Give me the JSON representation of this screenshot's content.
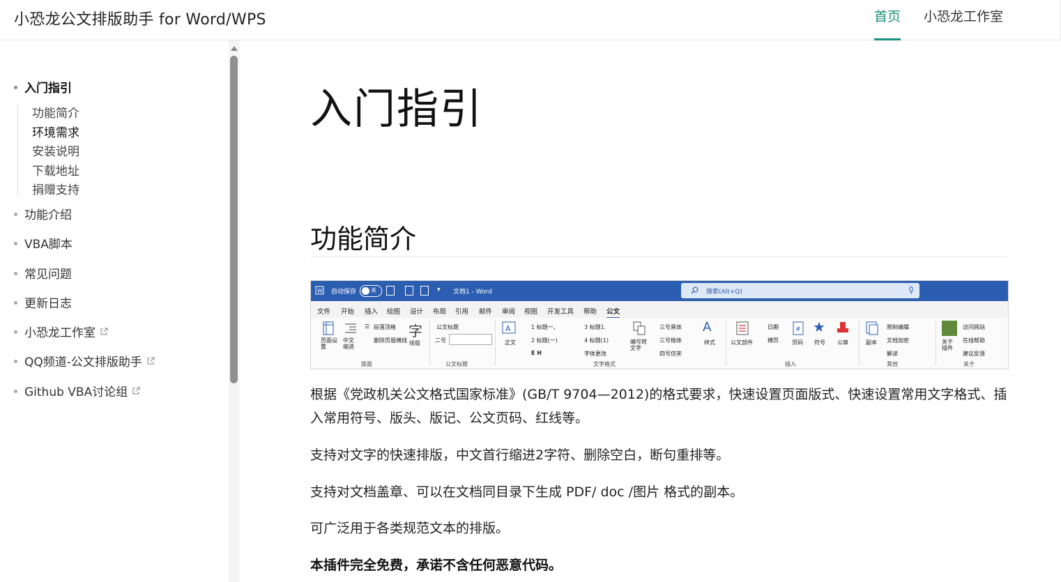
{
  "header": {
    "title": "小恐龙公文排版助手 for Word/WPS",
    "nav": [
      "首页",
      "小恐龙工作室"
    ]
  },
  "sidebar": {
    "items": [
      {
        "label": "入门指引"
      },
      {
        "label": "功能介绍"
      },
      {
        "label": "VBA脚本"
      },
      {
        "label": "常见问题"
      },
      {
        "label": "更新日志"
      },
      {
        "label": "小恐龙工作室"
      },
      {
        "label": "QQ频道-公文排版助手"
      },
      {
        "label": "Github VBA讨论组"
      }
    ],
    "subitems": [
      "功能简介",
      "环境需求",
      "安装说明",
      "下载地址",
      "捐赠支持"
    ]
  },
  "main": {
    "h1": "入门指引",
    "h2": "功能简介",
    "paragraphs": [
      "根据《党政机关公文格式国家标准》(GB/T 9704—2012)的格式要求，快速设置页面版式、快速设置常用文字格式、插入常用符号、版头、版记、公文页码、红线等。",
      "支持对文字的快速排版，中文首行缩进2字符、删除空白，断句重排等。",
      "支持对文档盖章、可以在文档同目录下生成 PDF/ doc /图片 格式的副本。",
      "可广泛用于各类规范文本的排版。"
    ],
    "bold_note": "本插件完全免费，承诺不含任何恶意代码。"
  },
  "screenshot": {
    "titlebar": {
      "autosave": "自动保存",
      "autosave_state": "关",
      "doc": "文档1 - Word",
      "search": "搜索(Alt+Q)"
    },
    "tabs": [
      "文件",
      "开始",
      "插入",
      "绘图",
      "设计",
      "布局",
      "引用",
      "邮件",
      "审阅",
      "视图",
      "开发工具",
      "帮助",
      "公文"
    ],
    "groups": [
      "版面",
      "公文标题",
      "文字格式",
      "插入",
      "其他",
      "关于"
    ],
    "buttons": {
      "page_setup": "页面设置",
      "indent": "中文缩进",
      "para_top": "段落顶格",
      "del_lines": "删除页眉横线",
      "layout": "排版",
      "official_title": "公文标题",
      "size_two": "二号",
      "body": "正文",
      "h1": "标题一、",
      "h2": "标题(一)",
      "h3": "标题1.",
      "h4": "标题(1)",
      "numbering": "编号转文字",
      "font_change": "字体更改",
      "f1": "三号黑体",
      "f2": "三号楷体",
      "f3": "四号仿宋",
      "style": "样式",
      "parts": "公文部件",
      "date": "日期",
      "landscape": "横页",
      "page_no": "页码",
      "symbol": "符号",
      "stamp": "公章",
      "copy": "副本",
      "restrict": "限制编辑",
      "encrypt": "文档加密",
      "unlock": "解读",
      "about": "关于插件",
      "site": "访问网站",
      "help": "在线帮助",
      "feedback": "建议反馈"
    }
  },
  "colors": {
    "accent": "#1a8f7c",
    "word_blue": "#2b5eb1"
  }
}
